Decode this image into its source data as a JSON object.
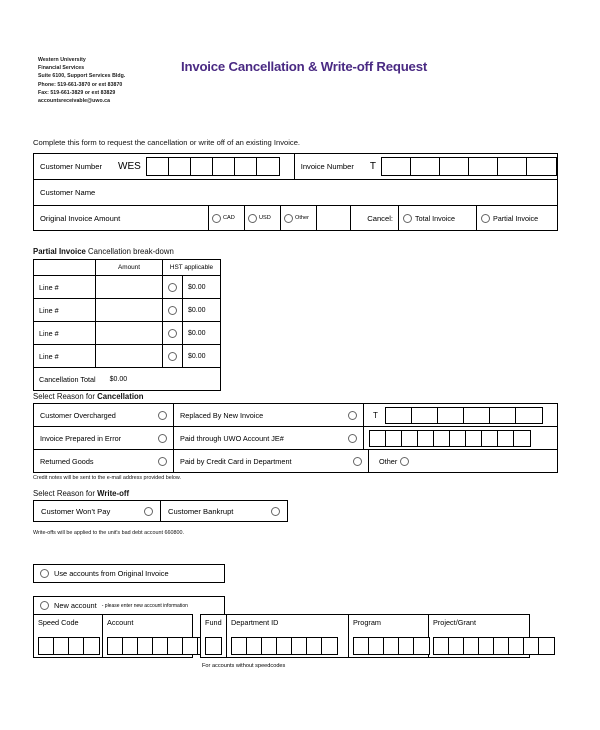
{
  "header": {
    "org_lines": [
      "Western University",
      "Financial Services",
      "Suite 6100, Support Services Bldg.",
      "Phone: 519-661-3870 or ext 83870",
      "Fax: 519-661-3829 or ext 83829",
      "accountsreceivable@uwo.ca"
    ],
    "title": "Invoice Cancellation & Write-off Request",
    "title_color": "#4a2a83"
  },
  "intro": "Complete this form to request the cancellation or write off of an existing Invoice.",
  "top_table": {
    "customer_number_label": "Customer Number",
    "customer_number_prefix": "WES",
    "customer_number_boxes": 6,
    "invoice_number_label": "Invoice Number",
    "invoice_number_prefix": "T",
    "invoice_number_boxes": 6,
    "customer_name_label": "Customer Name",
    "original_amount_label": "Original Invoice Amount",
    "currency_options": [
      "CAD",
      "USD",
      "Other"
    ],
    "cancel_label": "Cancel:",
    "cancel_options": [
      "Total Invoice",
      "Partial Invoice"
    ]
  },
  "partial": {
    "heading_bold": "Partial Invoice",
    "heading_rest": " Cancellation break-down",
    "columns": [
      "",
      "Amount",
      "HST applicable"
    ],
    "rows": [
      {
        "label": "Line #",
        "amount": "",
        "hst_value": "$0.00"
      },
      {
        "label": "Line #",
        "amount": "",
        "hst_value": "$0.00"
      },
      {
        "label": "Line #",
        "amount": "",
        "hst_value": "$0.00"
      },
      {
        "label": "Line #",
        "amount": "",
        "hst_value": "$0.00"
      }
    ],
    "total_label": "Cancellation Total",
    "total_value": "$0.00"
  },
  "cancellation": {
    "heading_prefix": "Select Reason for ",
    "heading_bold": "Cancellation",
    "row1": {
      "left": "Customer Overcharged",
      "mid": "Replaced By New Invoice",
      "right_prefix": "T",
      "right_boxes": 6
    },
    "row2": {
      "left": "Invoice Prepared in Error",
      "mid": "Paid through UWO Account JE#",
      "right_boxes": 10
    },
    "row3": {
      "left": "Returned Goods",
      "mid": "Paid by Credit Card in Department",
      "other": "Other"
    },
    "note": "Credit notes will be sent to the e-mail address provided below."
  },
  "writeoff": {
    "heading_prefix": "Select Reason for ",
    "heading_bold": "Write-off",
    "options": [
      "Customer Won't Pay",
      "Customer Bankrupt"
    ],
    "note": "Write-offs will be applied to the unit's bad debt account 660800."
  },
  "accounts": {
    "use_original_label": "Use accounts from Original Invoice",
    "new_account_label": "New account",
    "new_account_hint": "- please enter new account information",
    "fields": [
      {
        "label": "Speed Code",
        "boxes": 4
      },
      {
        "label": "Account",
        "boxes": 7
      },
      {
        "label": "Fund",
        "boxes": 1
      },
      {
        "label": "Department ID",
        "boxes": 7
      },
      {
        "label": "Program",
        "boxes": 5
      },
      {
        "label": "Project/Grant",
        "boxes": 8
      }
    ],
    "footnote": "For accounts without speedcodes"
  }
}
